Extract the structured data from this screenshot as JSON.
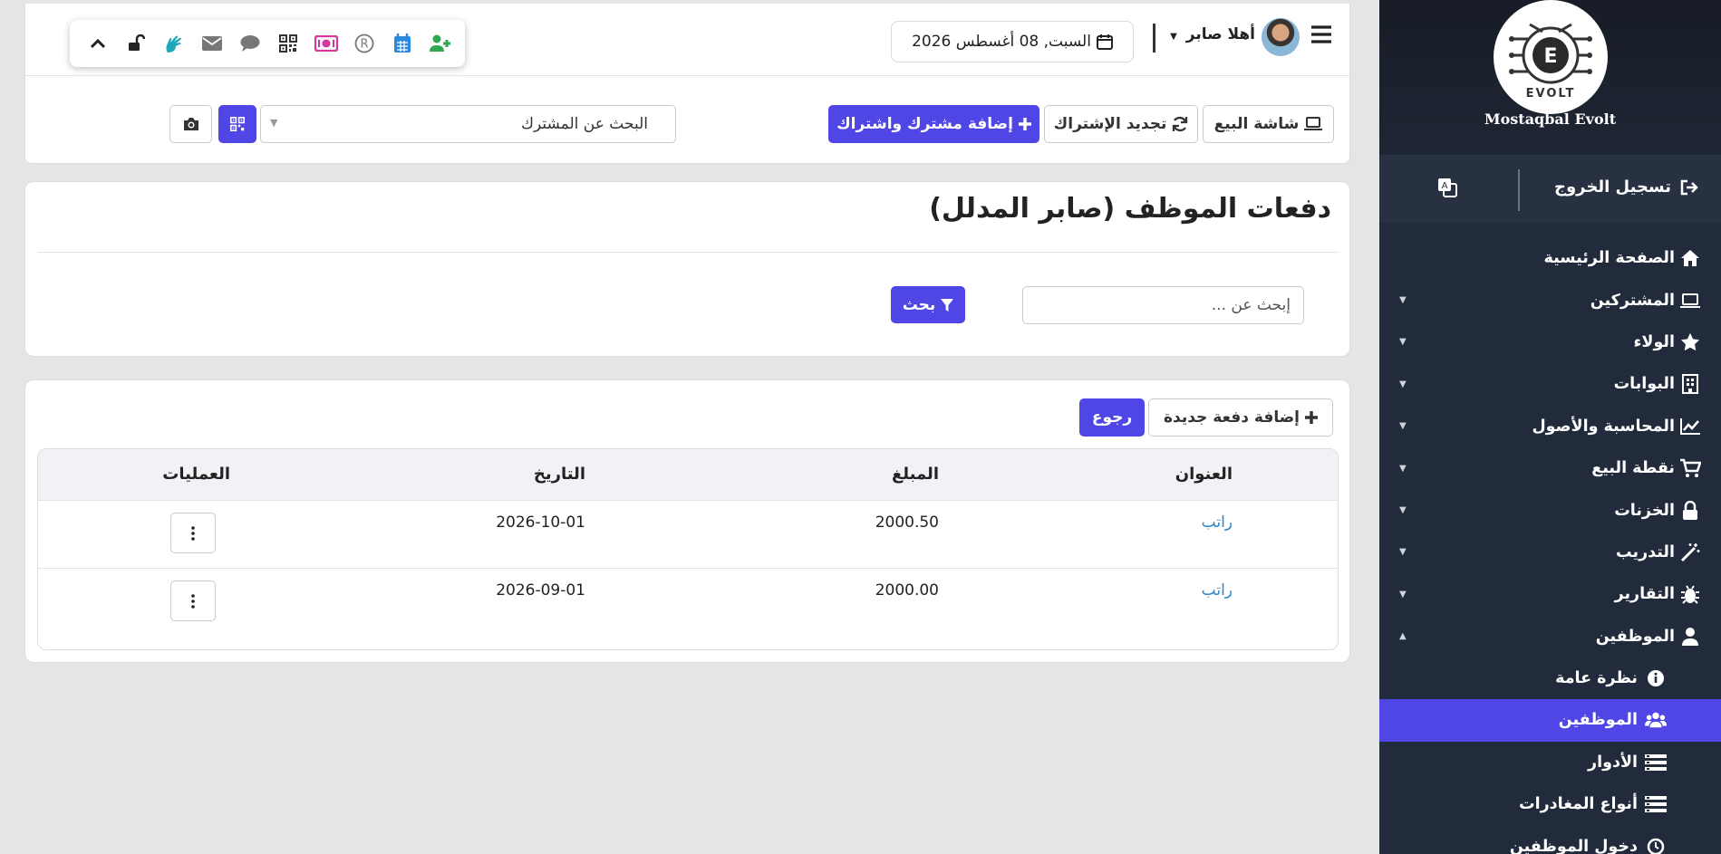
{
  "brand": {
    "name": "Mostaqbal Evolt",
    "logo_letter": "E",
    "logo_word": "EVOLT"
  },
  "sidebar": {
    "logout_label": "تسجيل الخروج",
    "items": [
      {
        "label": "الصفحة الرئيسية",
        "icon": "home-icon"
      },
      {
        "label": "المشتركين",
        "icon": "laptop-icon"
      },
      {
        "label": "الولاء",
        "icon": "star-icon"
      },
      {
        "label": "البوابات",
        "icon": "building-icon"
      },
      {
        "label": "المحاسبة والأصول",
        "icon": "chart-line-icon"
      },
      {
        "label": "نقطة البيع",
        "icon": "cart-icon"
      },
      {
        "label": "الخزنات",
        "icon": "lock-icon"
      },
      {
        "label": "التدريب",
        "icon": "magic-icon"
      },
      {
        "label": "التقارير",
        "icon": "bug-icon"
      },
      {
        "label": "الموظفين",
        "icon": "user-icon"
      },
      {
        "label": "نظرة عامة",
        "icon": "info-icon"
      },
      {
        "label": "الموظفين",
        "icon": "users-icon"
      },
      {
        "label": "الأدوار",
        "icon": "list-icon"
      },
      {
        "label": "أنواع المغادرات",
        "icon": "list-icon"
      },
      {
        "label": "دخول الموظفين",
        "icon": "clock-icon"
      }
    ]
  },
  "header": {
    "greeting": "أهلا صابر",
    "date": "السبت, 08 أغسطس 2026"
  },
  "toolbar": {
    "pos_label": "شاشة البيع",
    "renew_label": "تجديد الإشتراك",
    "add_sub_label": "إضافة مشترك واشتراك",
    "subscriber_search_placeholder": "البحث عن المشترك"
  },
  "page": {
    "title": "دفعات الموظف (صابر المدلل)",
    "search_placeholder": "إبحث عن ...",
    "search_button": "بحث",
    "add_payment_button": "إضافة دفعة جديدة",
    "back_button": "رجوع"
  },
  "table": {
    "columns": [
      "العنوان",
      "المبلغ",
      "التاريخ",
      "العمليات"
    ],
    "rows": [
      {
        "title": "راتب",
        "amount": "2000.50",
        "date": "2026-10-01"
      },
      {
        "title": "راتب",
        "amount": "2000.00",
        "date": "2026-09-01"
      }
    ]
  },
  "colors": {
    "primary": "#5046e5",
    "sidebar_bg": "#222b3c",
    "link": "#2f86c7"
  }
}
